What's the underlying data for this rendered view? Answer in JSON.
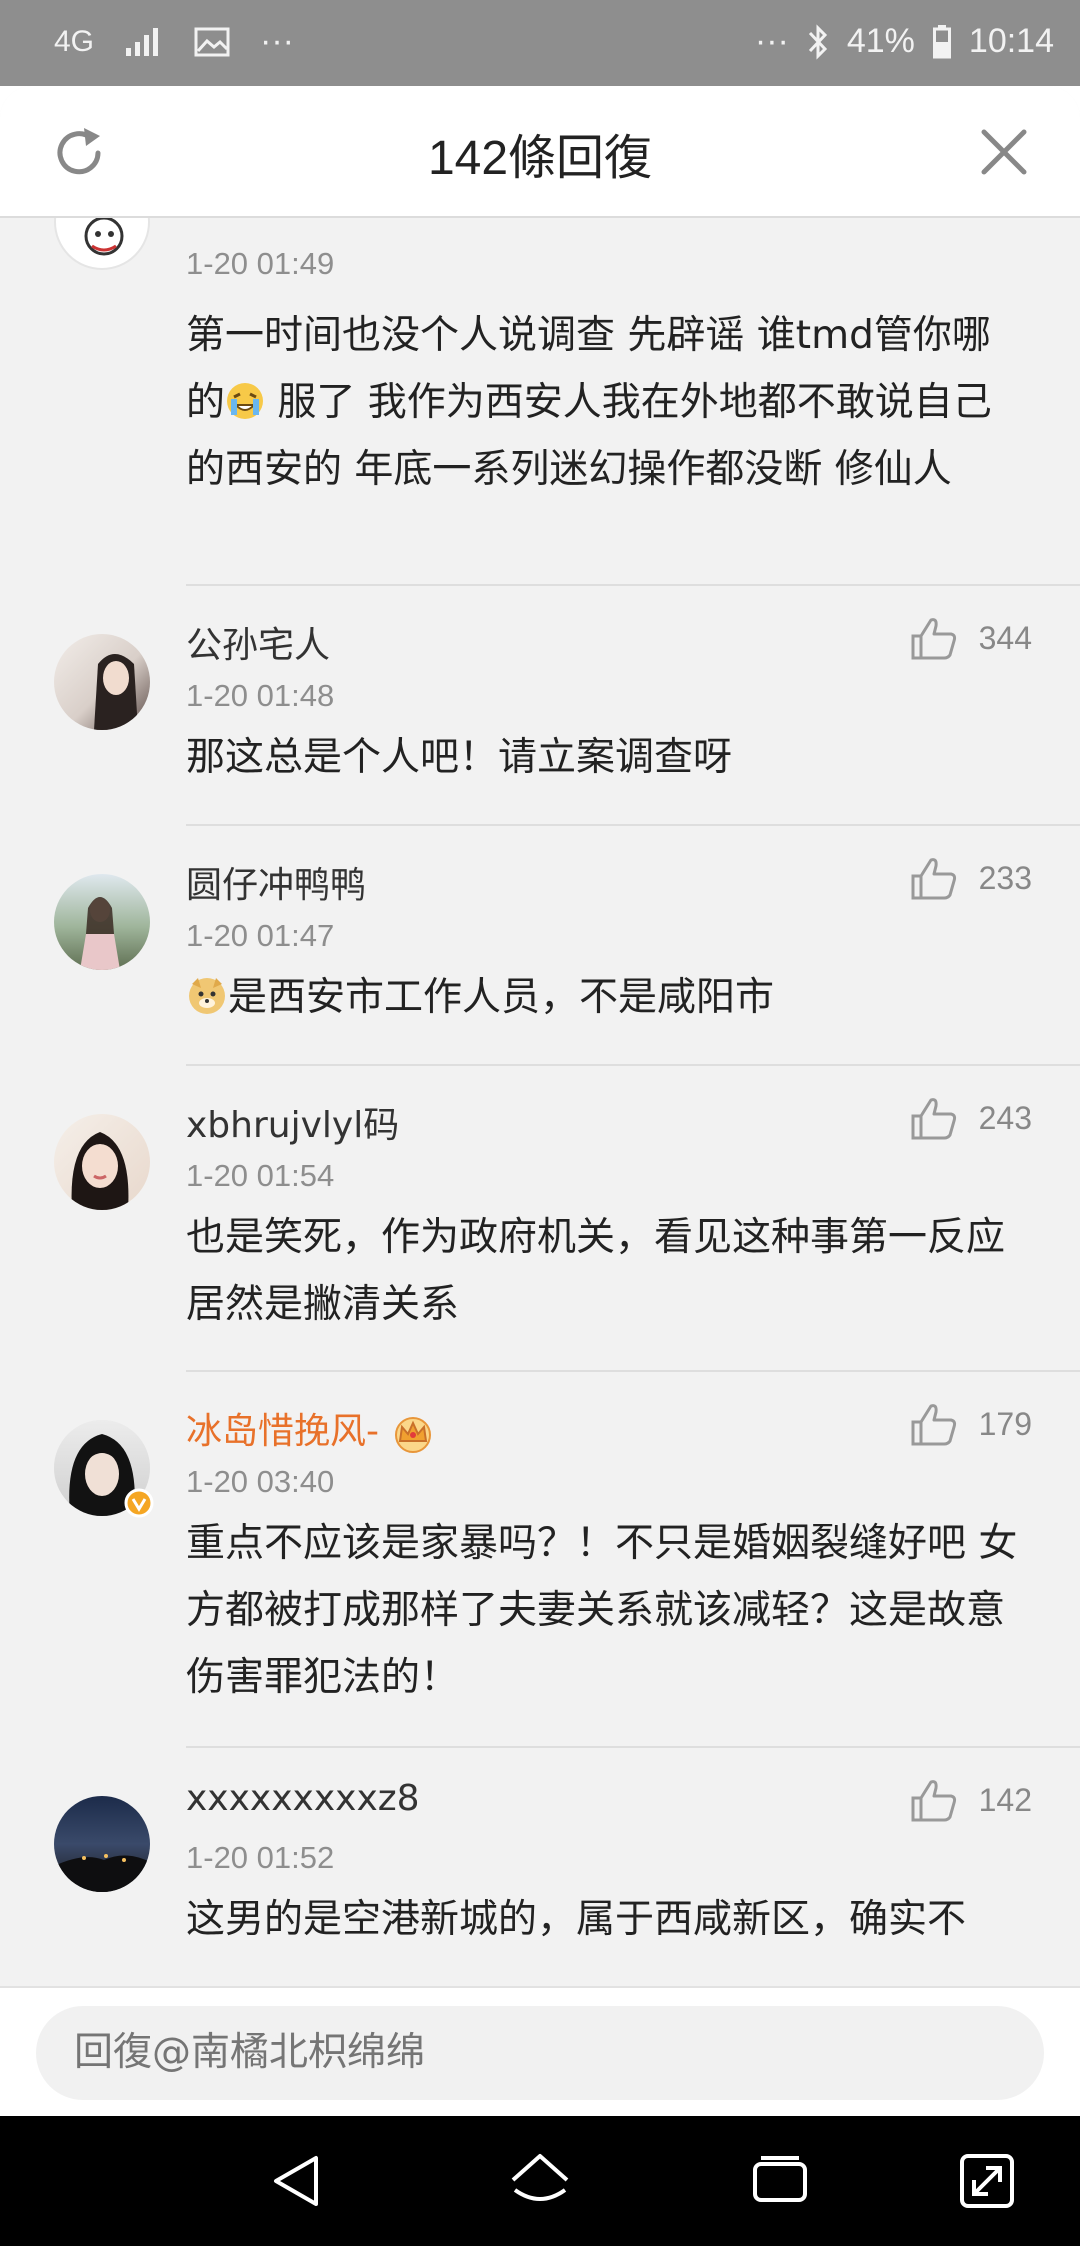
{
  "status_bar": {
    "network": "4G",
    "more": "···",
    "more_right": "···",
    "battery": "41%",
    "time": "10:14"
  },
  "header": {
    "title": "142條回復"
  },
  "comments": [
    {
      "time": "1-20 01:49",
      "text_before_emoji": "第一时间也没个人说调查 先辟谣 谁tmd管你哪的",
      "text_after_emoji": " 服了 我作为西安人我在外地都不敢说自己的西安的 年底一系列迷幻操作都没断 修仙人"
    },
    {
      "username": "公孙宅人",
      "time": "1-20 01:48",
      "likes": "344",
      "text": "那这总是个人吧！请立案调查呀"
    },
    {
      "username": "圆仔冲鸭鸭",
      "time": "1-20 01:47",
      "likes": "233",
      "text": "是西安市工作人员，不是咸阳市"
    },
    {
      "username": "xbhrujvlyl码",
      "time": "1-20 01:54",
      "likes": "243",
      "text": "也是笑死，作为政府机关，看见这种事第一反应居然是撇清关系"
    },
    {
      "username": "冰岛惜挽风-",
      "time": "1-20 03:40",
      "likes": "179",
      "text": "重点不应该是家暴吗？！不只是婚姻裂缝好吧 女方都被打成那样了夫妻关系就该减轻？这是故意伤害罪犯法的！"
    },
    {
      "username": "xxxxxxxxxz8",
      "time": "1-20 01:52",
      "likes": "142",
      "text": "这男的是空港新城的，属于西咸新区，确实不"
    }
  ],
  "reply": {
    "placeholder": "回復@南橘北枳绵绵"
  },
  "colors": {
    "vip_name": "#e8712a",
    "sheet_bg": "#f2f2f2",
    "status_bar_bg": "#8e8e8e"
  },
  "icons": {
    "refresh": "refresh-icon",
    "close": "close-icon",
    "like": "thumbs-up-icon",
    "crown": "crown-icon",
    "verified": "verified-badge-icon"
  }
}
